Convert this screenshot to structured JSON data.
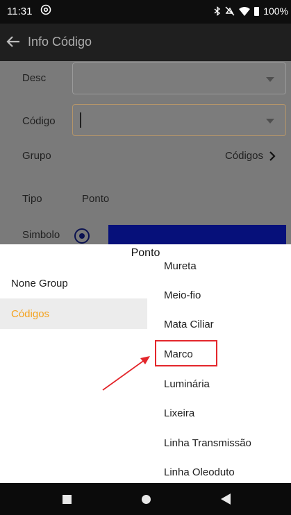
{
  "status_bar": {
    "time": "11:31",
    "battery": "100%"
  },
  "app_bar": {
    "title": "Info Código"
  },
  "form": {
    "desc_label": "Desc",
    "codigo_label": "Código",
    "grupo_label": "Grupo",
    "grupo_value": "Códigos",
    "tipo_label": "Tipo",
    "tipo_value": "Ponto",
    "simbolo_label": "Simbolo",
    "symbol_color": "#06107a"
  },
  "sheet": {
    "title": "Ponto",
    "groups": [
      {
        "label": "None Group"
      },
      {
        "label": "Códigos"
      }
    ],
    "codes": [
      {
        "label": "Mureta"
      },
      {
        "label": "Meio-fio"
      },
      {
        "label": "Mata Ciliar"
      },
      {
        "label": "Marco"
      },
      {
        "label": "Luminária"
      },
      {
        "label": "Lixeira"
      },
      {
        "label": "Linha Transmissão"
      },
      {
        "label": "Linha Oleoduto"
      }
    ]
  },
  "colors": {
    "accent_selected": "#f4a21d",
    "annotation_red": "#e3262b"
  }
}
